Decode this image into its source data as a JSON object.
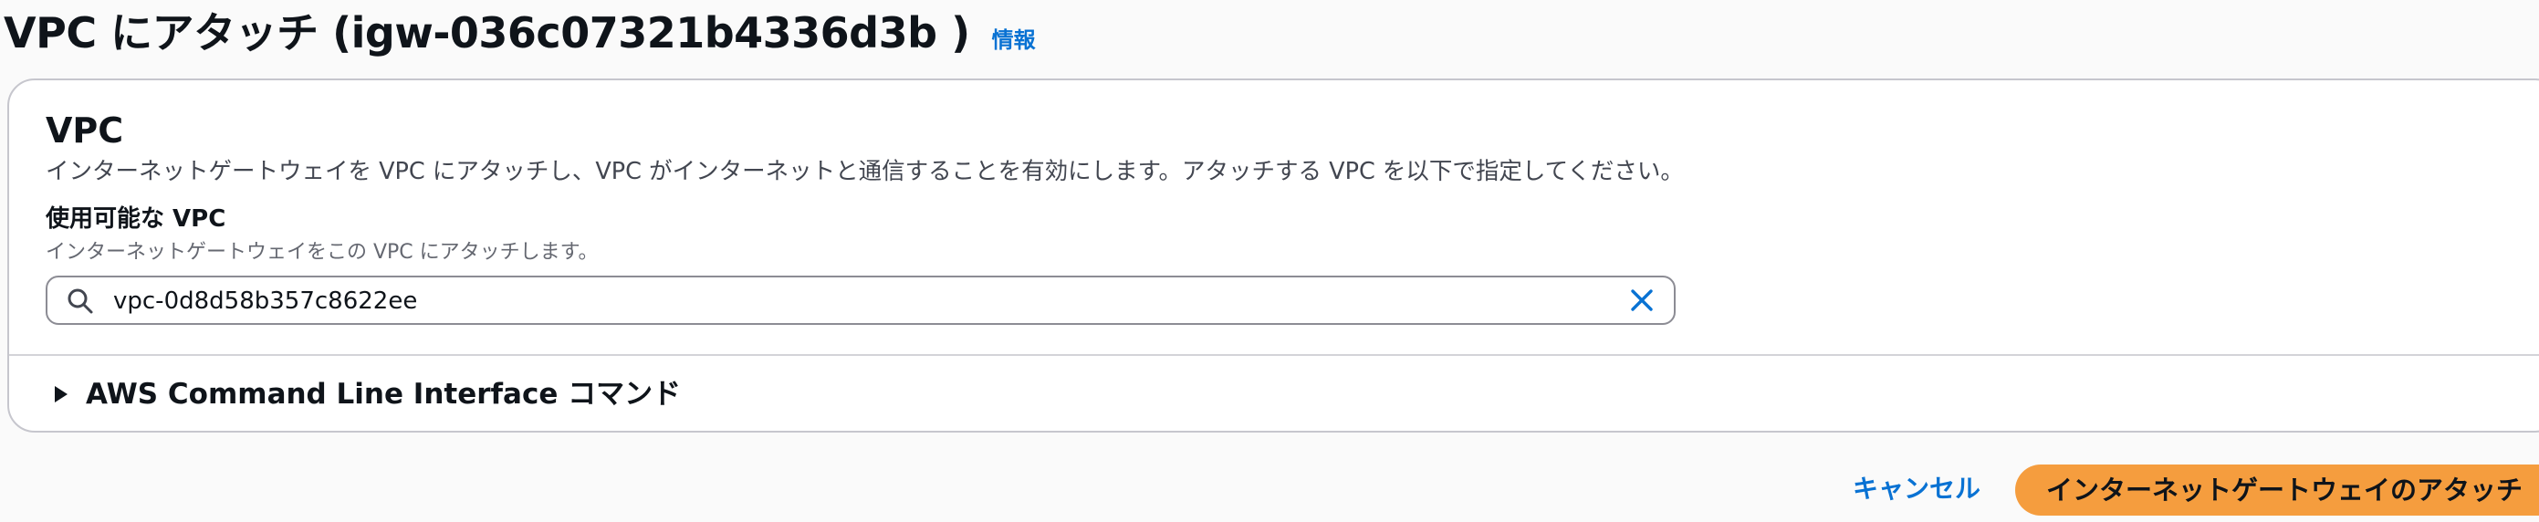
{
  "header": {
    "title": "VPC にアタッチ (igw-036c07321b4336d3b )",
    "info_link": "情報"
  },
  "panel": {
    "title": "VPC",
    "description": "インターネットゲートウェイを VPC にアタッチし、VPC がインターネットと通信することを有効にします。アタッチする VPC を以下で指定してください。",
    "field": {
      "label": "使用可能な VPC",
      "description": "インターネットゲートウェイをこの VPC にアタッチします。",
      "value": "vpc-0d8d58b357c8622ee",
      "search_icon": "search-icon",
      "clear_icon": "close-icon"
    },
    "cli_expander": {
      "label": "AWS Command Line Interface コマンド",
      "icon": "caret-right-icon"
    }
  },
  "actions": {
    "cancel_label": "キャンセル",
    "primary_label": "インターネットゲートウェイのアタッチ"
  },
  "colors": {
    "accent_link": "#0972d3",
    "primary_button": "#f59d3e",
    "text": "#0f141a",
    "secondary_text": "#656871",
    "panel_border": "#c6c6cd",
    "background": "#fafafa"
  }
}
